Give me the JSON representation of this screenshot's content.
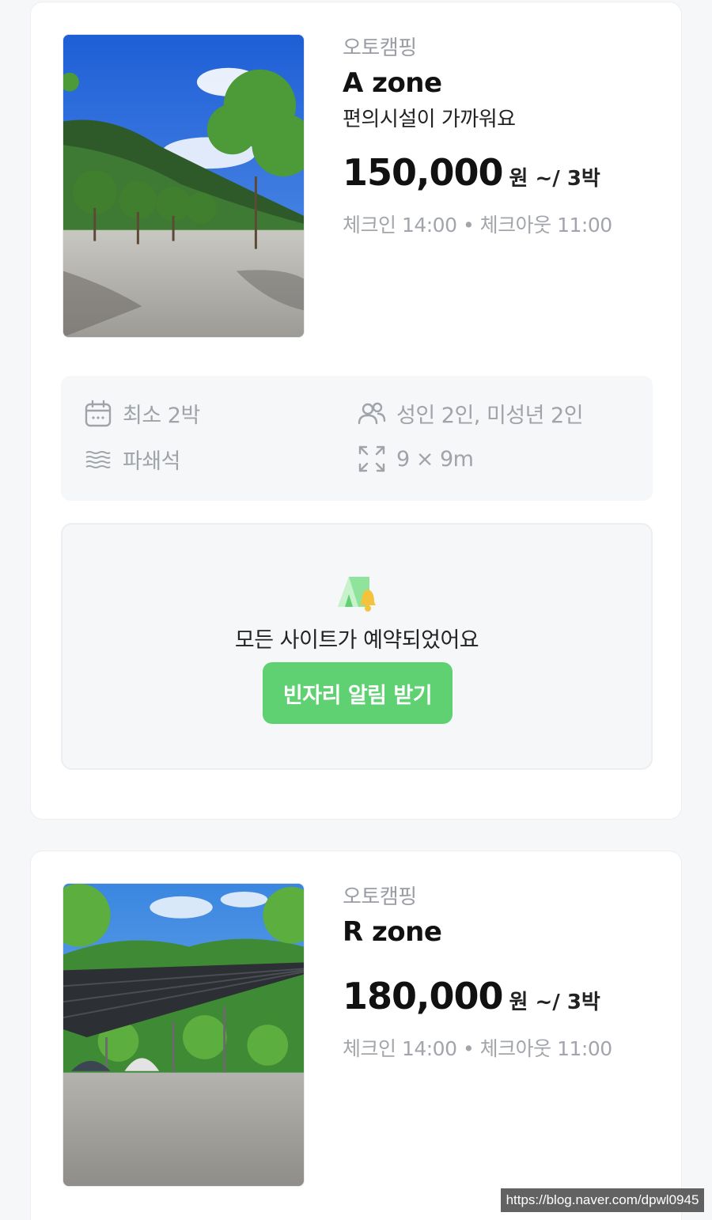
{
  "sites": [
    {
      "category": "오토캠핑",
      "name": "A zone",
      "description": "편의시설이 가까워요",
      "price": "150,000",
      "price_unit": "원 ~/ 3박",
      "checkinout": "체크인 14:00 • 체크아웃 11:00",
      "features": {
        "min_nights": "최소 2박",
        "capacity": "성인 2인, 미성년 2인",
        "floor": "파쇄석",
        "size": "9 × 9m"
      },
      "soldout": {
        "message": "모든 사이트가 예약되었어요",
        "button_label": "빈자리 알림 받기"
      }
    },
    {
      "category": "오토캠핑",
      "name": "R zone",
      "price": "180,000",
      "price_unit": "원 ~/ 3박",
      "checkinout": "체크인 14:00 • 체크아웃 11:00"
    }
  ],
  "icons": {
    "min_nights": "calendar-icon",
    "capacity": "people-icon",
    "floor": "gravel-icon",
    "size": "expand-icon",
    "soldout": "tent-bell-icon"
  },
  "colors": {
    "accent": "#5fd172",
    "muted_text": "#a0a3a9",
    "panel_bg": "#f6f7f9"
  },
  "watermark": "https://blog.naver.com/dpwl0945"
}
